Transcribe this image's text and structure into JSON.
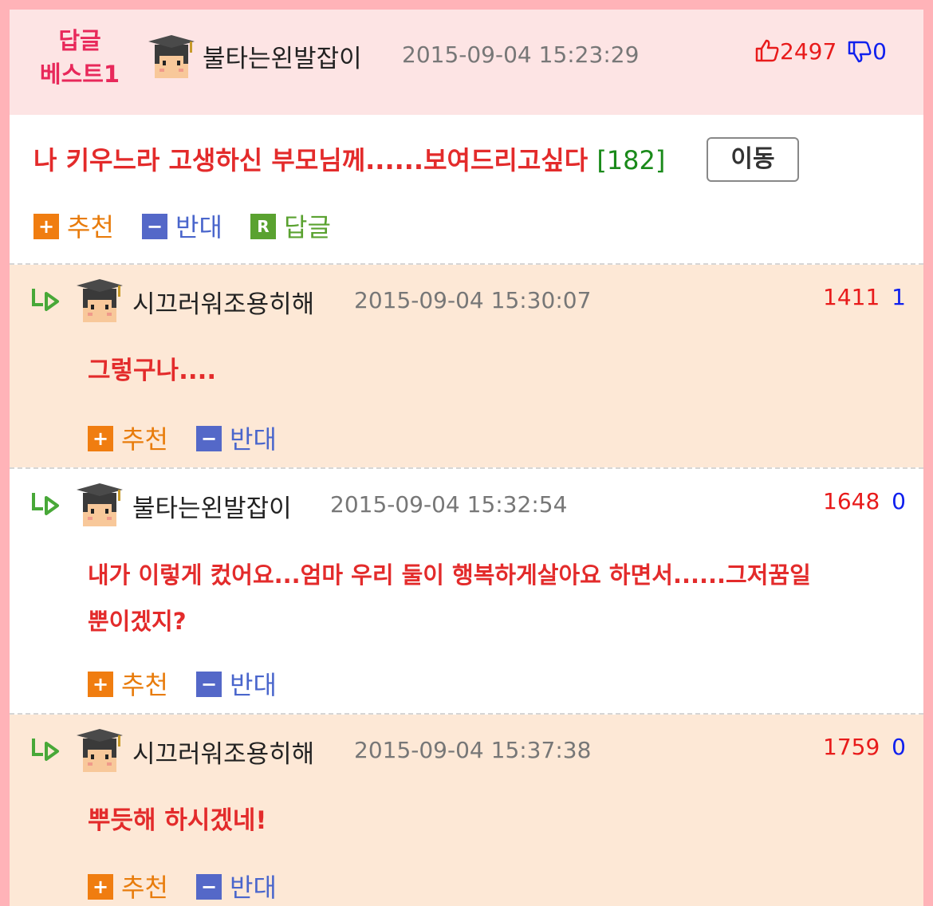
{
  "best": {
    "label_line1": "답글",
    "label_line2": "베스트1",
    "nickname": "불타는왼발잡이",
    "datetime": "2015-09-04 15:23:29",
    "up": "2497",
    "down": "0",
    "title": "나 키우느라 고생하신 부모님께......보여드리고싶다",
    "comment_count": "[182]",
    "move_button": "이동",
    "actions": {
      "recommend": "추천",
      "oppose": "반대",
      "reply": "답글"
    }
  },
  "replies": [
    {
      "nickname": "시끄러워조용히해",
      "datetime": "2015-09-04 15:30:07",
      "up": "1411",
      "down": "1",
      "text": "그렇구나....",
      "recommend": "추천",
      "oppose": "반대"
    },
    {
      "nickname": "불타는왼발잡이",
      "datetime": "2015-09-04 15:32:54",
      "up": "1648",
      "down": "0",
      "text_line1": "내가 이렇게 컸어요...엄마 우리 둘이 행복하게살아요 하면서......그저꿈일",
      "text_line2": "뿐이겠지?",
      "recommend": "추천",
      "oppose": "반대"
    },
    {
      "nickname": "시끄러워조용히해",
      "datetime": "2015-09-04 15:37:38",
      "up": "1759",
      "down": "0",
      "text": "뿌듯해 하시겠네!",
      "recommend": "추천",
      "oppose": "반대"
    }
  ],
  "icons": {
    "avatar": "student-avatar-icon",
    "thumb_up": "thumbs-up-icon",
    "thumb_down": "thumbs-down-icon",
    "reply_arrow": "reply-arrow-icon"
  },
  "colors": {
    "accent_red": "#e32b2b",
    "up": "#e81b1b",
    "down": "#1020ee",
    "recommend": "#f07d10",
    "oppose": "#5468c8",
    "reply": "#5aa230",
    "peach_bg": "#fde8d6",
    "best_bg": "#fde4e4"
  }
}
